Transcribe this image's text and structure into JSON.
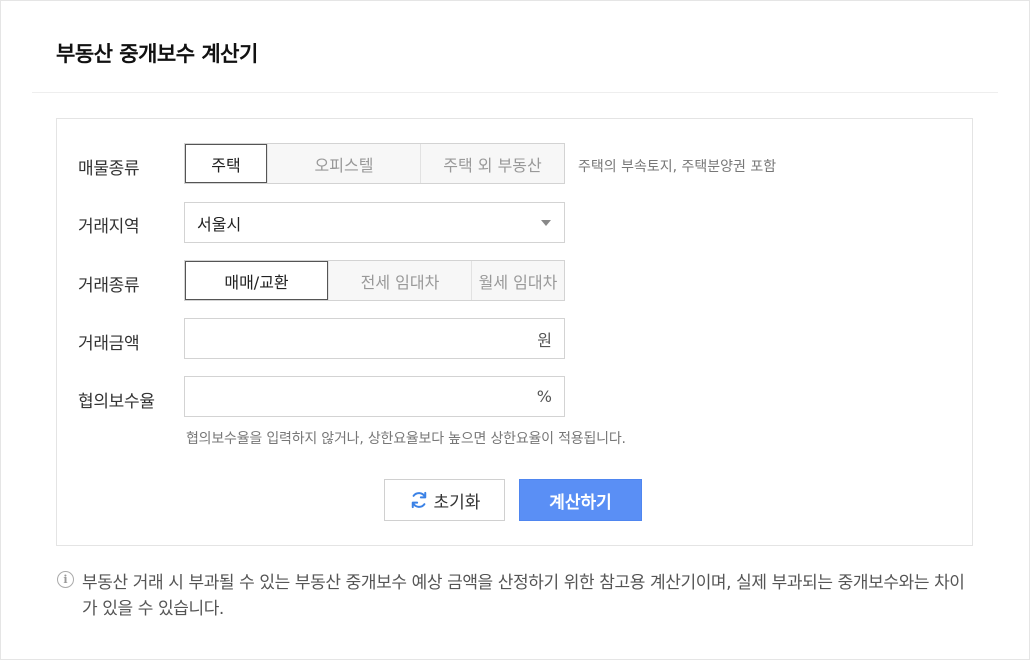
{
  "title": "부동산 중개보수 계산기",
  "property_type": {
    "label": "매물종류",
    "options": [
      "주택",
      "오피스텔",
      "주택 외 부동산"
    ],
    "selected": "주택",
    "hint": "주택의 부속토지, 주택분양권 포함"
  },
  "region": {
    "label": "거래지역",
    "value": "서울시"
  },
  "deal_type": {
    "label": "거래종류",
    "options": [
      "매매/교환",
      "전세 임대차",
      "월세 임대차"
    ],
    "selected": "매매/교환"
  },
  "amount": {
    "label": "거래금액",
    "value": "",
    "unit": "원"
  },
  "rate": {
    "label": "협의보수율",
    "value": "",
    "unit": "%",
    "note": "협의보수율을 입력하지 않거나, 상한요율보다 높으면 상한요율이 적용됩니다."
  },
  "buttons": {
    "reset": "초기화",
    "calculate": "계산하기"
  },
  "footnote": "부동산 거래 시 부과될 수 있는 부동산 중개보수 예상 금액을 산정하기 위한 참고용 계산기이며, 실제 부과되는 중개보수와는 차이가 있을 수 있습니다.",
  "colors": {
    "accent": "#5a8ff5",
    "muted_text": "#777777"
  }
}
